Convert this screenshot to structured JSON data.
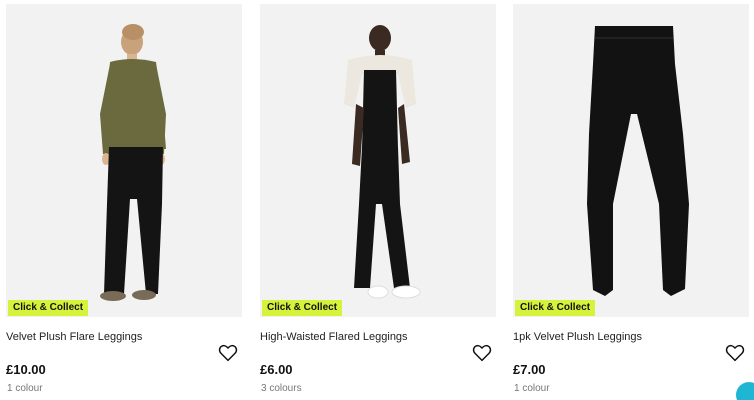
{
  "products": [
    {
      "image_alt": "Model wearing olive ribbed top with black flare leggings",
      "badge": "Click & Collect",
      "title": "Velvet Plush Flare Leggings",
      "price": "£10.00",
      "colours": "1 colour",
      "wishlist_icon": "heart-outline-icon"
    },
    {
      "image_alt": "Model wearing black top, cream knit over shoulders and black flared leggings",
      "badge": "Click & Collect",
      "title": "High-Waisted Flared Leggings",
      "price": "£6.00",
      "colours": "3 colours",
      "wishlist_icon": "heart-outline-icon"
    },
    {
      "image_alt": "Flat-lay of black velvet plush leggings",
      "badge": "Click & Collect",
      "title": "1pk Velvet Plush Leggings",
      "price": "£7.00",
      "colours": "1 colour",
      "wishlist_icon": "heart-outline-icon"
    }
  ],
  "colors": {
    "badge_bg": "#d7f23b",
    "image_bg": "#f2f2f2",
    "accent": "#1fb6d4"
  }
}
